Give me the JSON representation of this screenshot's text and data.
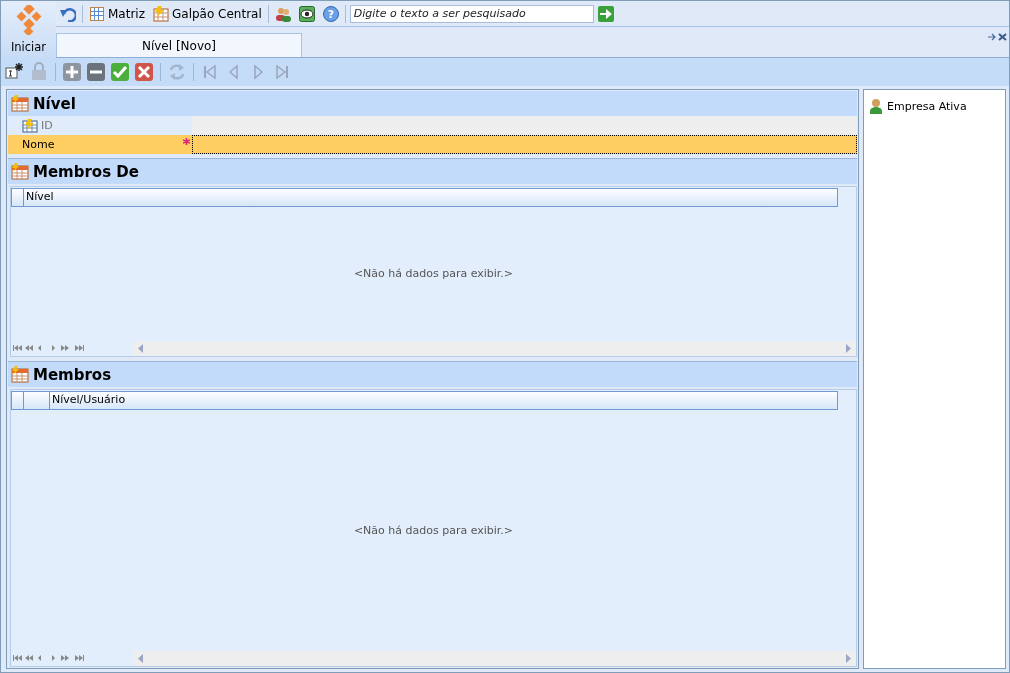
{
  "app_button": {
    "label": "Iniciar"
  },
  "quick_toolbar": {
    "items": [
      {
        "kind": "undo"
      },
      {
        "kind": "sep"
      },
      {
        "kind": "grid",
        "label": "Matriz"
      },
      {
        "kind": "warehouse",
        "label": "Galpão Central"
      },
      {
        "kind": "sep"
      },
      {
        "kind": "users"
      },
      {
        "kind": "eye"
      },
      {
        "kind": "help",
        "glyph": "?"
      }
    ],
    "search": {
      "placeholder": "Digite o texto a ser pesquisado"
    }
  },
  "tabs": [
    {
      "label": "Nível [Novo]",
      "selected": true
    }
  ],
  "record_toolbar": [
    {
      "kind": "new",
      "disabled": false
    },
    {
      "kind": "lock",
      "disabled": true
    },
    {
      "kind": "sep"
    },
    {
      "kind": "add",
      "disabled": false
    },
    {
      "kind": "remove",
      "disabled": false
    },
    {
      "kind": "save",
      "disabled": false
    },
    {
      "kind": "cancel",
      "disabled": false
    },
    {
      "kind": "sep"
    },
    {
      "kind": "refresh",
      "disabled": true
    },
    {
      "kind": "sep"
    },
    {
      "kind": "first",
      "disabled": true
    },
    {
      "kind": "prev",
      "disabled": true
    },
    {
      "kind": "next",
      "disabled": true
    },
    {
      "kind": "last",
      "disabled": true
    }
  ],
  "form": {
    "title": "Nível",
    "fields": [
      {
        "label": "ID",
        "kind": "auto",
        "required": false,
        "selected": false
      },
      {
        "label": "Nome",
        "kind": "text",
        "required": true,
        "selected": true
      }
    ]
  },
  "grids": [
    {
      "title": "Membros De",
      "kind": "flat",
      "columns": [
        {
          "label": "Nível"
        }
      ],
      "empty_text": "<Não há dados para exibir.>"
    },
    {
      "title": "Membros",
      "kind": "tree",
      "columns": [
        {
          "label": "Nível/Usuário"
        }
      ],
      "empty_text": "<Não há dados para exibir.>"
    }
  ],
  "side_panel": {
    "items": [
      {
        "label": "Empresa Ativa"
      }
    ]
  }
}
